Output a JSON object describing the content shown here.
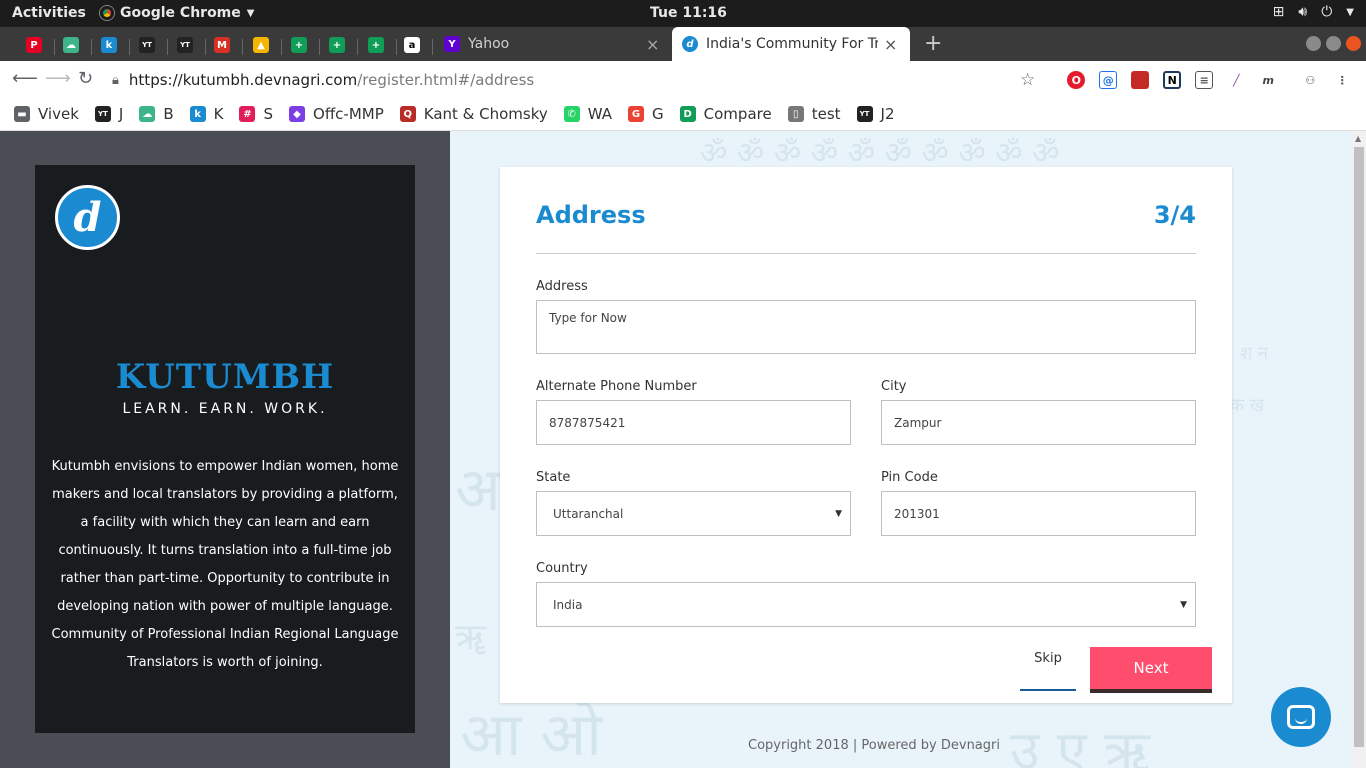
{
  "os": {
    "activities": "Activities",
    "app_name": "Google Chrome",
    "clock": "Tue 11:16"
  },
  "tabs": {
    "pinned": [
      {
        "icon": "pinterest-icon",
        "color": "#e60023",
        "glyph": "P"
      },
      {
        "icon": "cloud-icon",
        "color": "#3eb489",
        "glyph": "☁"
      },
      {
        "icon": "k-icon",
        "color": "#1a8bd1",
        "glyph": "k"
      },
      {
        "icon": "yt-icon",
        "color": "#222222",
        "glyph": "YT"
      },
      {
        "icon": "yt-icon",
        "color": "#222222",
        "glyph": "YT"
      },
      {
        "icon": "gmail-icon",
        "color": "#d93025",
        "glyph": "M"
      },
      {
        "icon": "drive-icon",
        "color": "#f4b400",
        "glyph": "▲"
      },
      {
        "icon": "sheets-icon",
        "color": "#0f9d58",
        "glyph": "+"
      },
      {
        "icon": "sheets-icon",
        "color": "#0f9d58",
        "glyph": "+"
      },
      {
        "icon": "sheets-icon",
        "color": "#0f9d58",
        "glyph": "+"
      },
      {
        "icon": "amazon-icon",
        "color": "#ffffff",
        "glyph": "a"
      }
    ],
    "yahoo": "Yahoo",
    "active": "India's Community For Tra"
  },
  "toolbar": {
    "url_host": "https://kutumbh.devnagri.com",
    "url_path": "/register.html#/address"
  },
  "bookmarks": [
    {
      "label": "Vivek",
      "icon": "folder-icon",
      "color": "#5f6368",
      "glyph": "▬"
    },
    {
      "label": "J",
      "icon": "yt-icon",
      "color": "#222222",
      "glyph": "YT"
    },
    {
      "label": "B",
      "icon": "cloud-icon",
      "color": "#3eb489",
      "glyph": "☁"
    },
    {
      "label": "K",
      "icon": "k-icon",
      "color": "#1a8bd1",
      "glyph": "k"
    },
    {
      "label": "S",
      "icon": "slack-icon",
      "color": "#e01e5a",
      "glyph": "#"
    },
    {
      "label": "Offc-MMP",
      "icon": "mmp-icon",
      "color": "#7b3fe4",
      "glyph": "◆"
    },
    {
      "label": "Kant & Chomsky",
      "icon": "quora-icon",
      "color": "#b92b27",
      "glyph": "Q"
    },
    {
      "label": "WA",
      "icon": "whatsapp-icon",
      "color": "#25d366",
      "glyph": "✆"
    },
    {
      "label": "G",
      "icon": "google-icon",
      "color": "#ea4335",
      "glyph": "G"
    },
    {
      "label": "Compare",
      "icon": "d-icon",
      "color": "#0f9d58",
      "glyph": "D"
    },
    {
      "label": "test",
      "icon": "page-icon",
      "color": "#777777",
      "glyph": "▯"
    },
    {
      "label": "J2",
      "icon": "yt-icon",
      "color": "#222222",
      "glyph": "YT"
    }
  ],
  "sidebar": {
    "brand": "KUTUMBH",
    "tagline": "LEARN. EARN. WORK.",
    "description": "Kutumbh envisions to empower Indian women, home makers and local translators by providing a platform, a facility with which they can learn and earn continuously. It turns translation into a full-time job rather than part-time. Opportunity to contribute in developing nation with power of multiple language. Community of Professional Indian Regional Language Translators is worth of joining."
  },
  "form": {
    "title": "Address",
    "step": "3/4",
    "address_label": "Address",
    "address_placeholder": "Type for Now",
    "alt_phone_label": "Alternate Phone Number",
    "alt_phone_value": "8787875421",
    "city_label": "City",
    "city_value": "Zampur",
    "state_label": "State",
    "state_value": "Uttaranchal",
    "pincode_label": "Pin Code",
    "pincode_value": "201301",
    "country_label": "Country",
    "country_value": "India",
    "skip_label": "Skip",
    "next_label": "Next"
  },
  "footer": "Copyright 2018 | Powered by Devnagri",
  "colors": {
    "accent": "#1a8bd1",
    "next_button": "#ff4d6d",
    "sidebar_bg": "#191c1e"
  }
}
